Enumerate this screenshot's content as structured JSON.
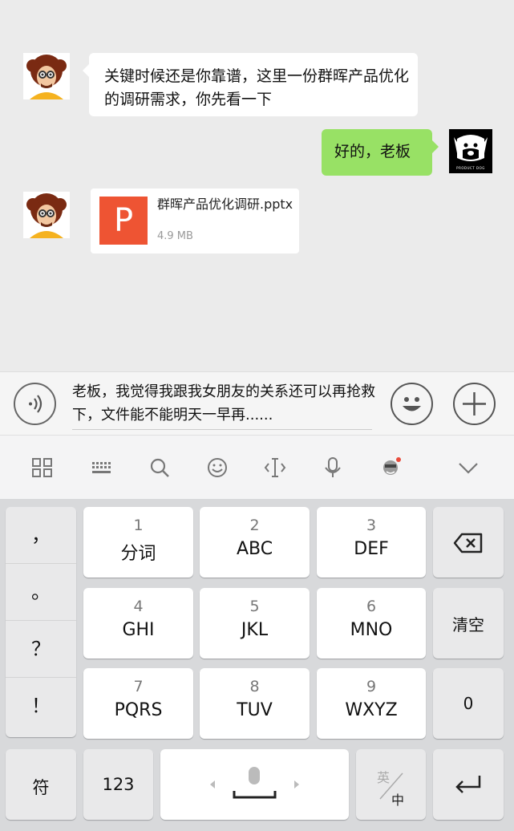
{
  "chat": {
    "msg1_text": "关键时候还是你靠谱，这里一份群晖产品优化的调研需求，你先看一下",
    "msg2_text": "好的，老板",
    "file": {
      "icon_letter": "P",
      "name": "群晖产品优化调研.pptx",
      "size": "4.9 MB"
    },
    "right_avatar_caption": "PRODUCT DOG"
  },
  "input": {
    "text": "老板，我觉得我跟我女朋友的关系还可以再抢救下，文件能不能明天一早再......"
  },
  "icons": {
    "voice": "voice-icon",
    "emoji": "emoji-icon",
    "plus": "plus-icon",
    "grid": "grid-icon",
    "keyboard": "keyboard-icon",
    "search": "search-icon",
    "smile": "smile-icon",
    "cursor": "cursor-icon",
    "mic": "mic-icon",
    "skin": "skin-icon",
    "collapse": "chevron-down-icon"
  },
  "keyboard": {
    "punctuation": [
      "，",
      "。",
      "？",
      "！"
    ],
    "keys": [
      {
        "num": "1",
        "label": "分词"
      },
      {
        "num": "2",
        "label": "ABC"
      },
      {
        "num": "3",
        "label": "DEF"
      },
      {
        "num": "4",
        "label": "GHI"
      },
      {
        "num": "5",
        "label": "JKL"
      },
      {
        "num": "6",
        "label": "MNO"
      },
      {
        "num": "7",
        "label": "PQRS"
      },
      {
        "num": "8",
        "label": "TUV"
      },
      {
        "num": "9",
        "label": "WXYZ"
      }
    ],
    "clear": "清空",
    "zero": "0",
    "symbols": "符",
    "numbers": "123",
    "lang_top": "英",
    "lang_bottom": "中"
  },
  "colors": {
    "accent_green": "#98e165",
    "ppt_orange": "#ee5433",
    "notification_dot": "#e94b3c"
  }
}
